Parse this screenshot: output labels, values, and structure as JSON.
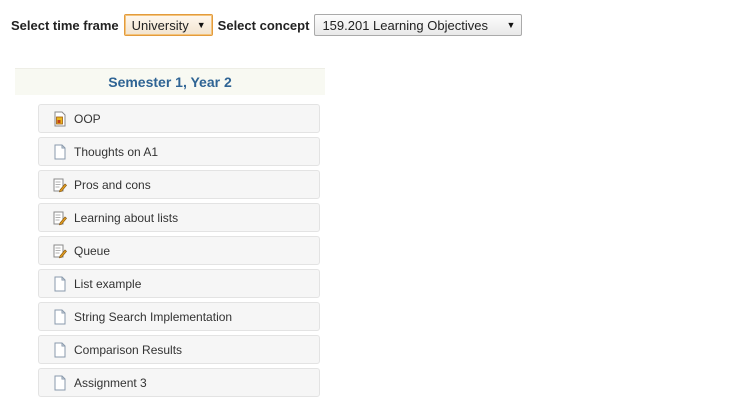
{
  "toolbar": {
    "timeframe_label": "Select time frame",
    "timeframe_value": "University",
    "concept_label": "Select concept",
    "concept_value": "159.201 Learning Objectives"
  },
  "semester": {
    "title": "Semester 1, Year 2"
  },
  "items": [
    {
      "label": "OOP",
      "icon": "image-document-icon"
    },
    {
      "label": "Thoughts on A1",
      "icon": "document-icon"
    },
    {
      "label": "Pros and cons",
      "icon": "edit-document-icon"
    },
    {
      "label": "Learning about lists",
      "icon": "edit-document-icon"
    },
    {
      "label": "Queue",
      "icon": "edit-document-icon"
    },
    {
      "label": "List example",
      "icon": "document-icon"
    },
    {
      "label": "String Search Implementation",
      "icon": "document-icon"
    },
    {
      "label": "Comparison Results",
      "icon": "document-icon"
    },
    {
      "label": "Assignment 3",
      "icon": "document-icon"
    }
  ],
  "colors": {
    "semester_title": "#2f6494",
    "focus_border": "#e39b3c"
  }
}
